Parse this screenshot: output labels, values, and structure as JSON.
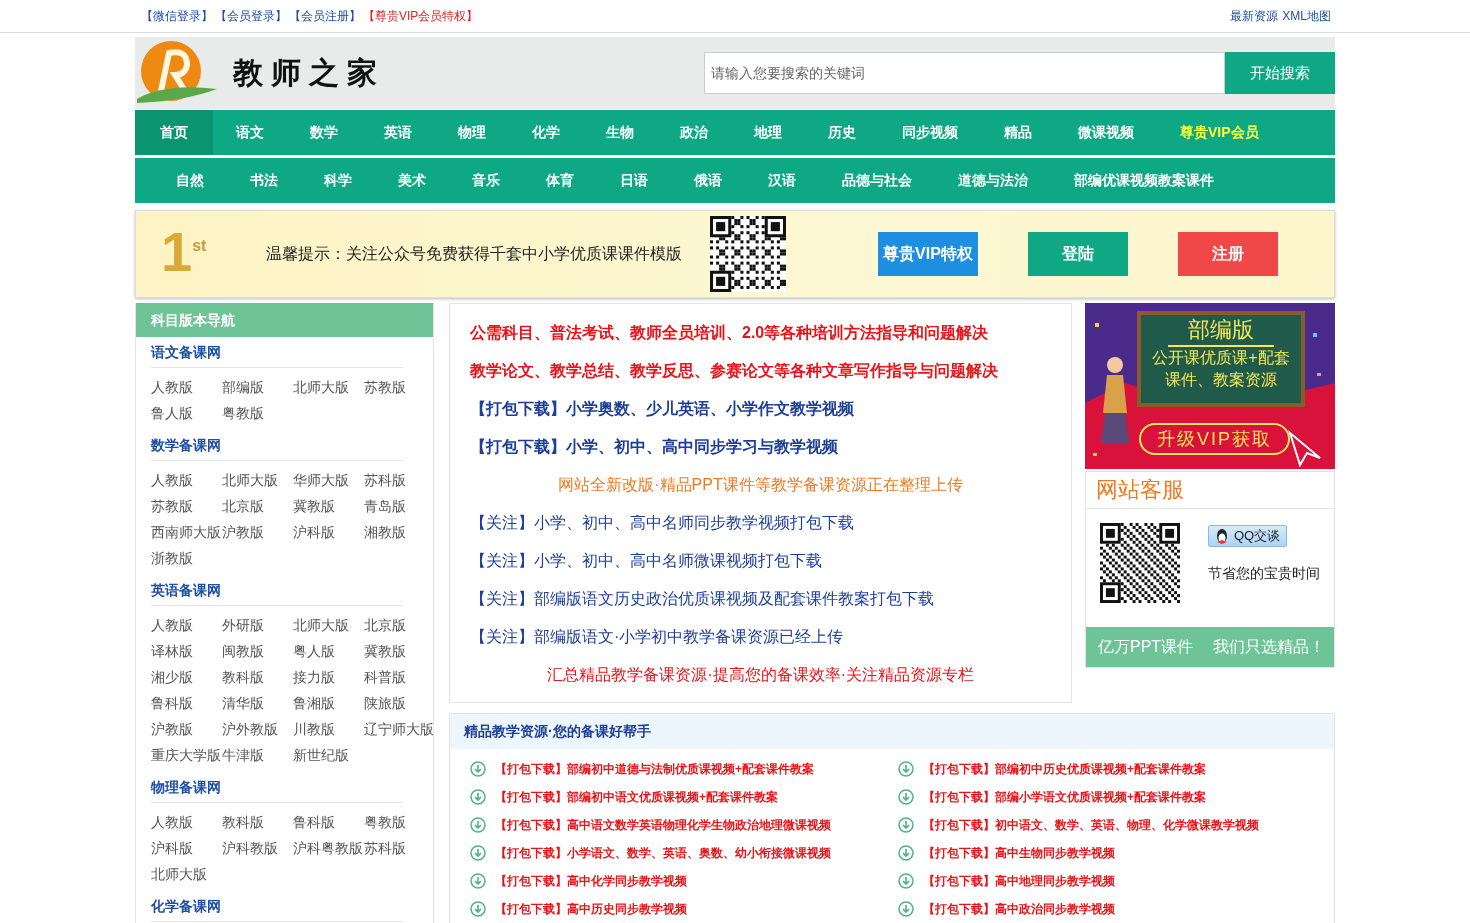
{
  "top_bar": {
    "left_links": [
      {
        "text": "【微信登录】",
        "kind": "normal"
      },
      {
        "text": "【会员登录】",
        "kind": "normal"
      },
      {
        "text": "【会员注册】",
        "kind": "normal"
      },
      {
        "text": "【尊贵VIP会员特权】",
        "kind": "vip"
      }
    ],
    "right_links": [
      "最新资源",
      "XML地图"
    ]
  },
  "header": {
    "site_title": "教师之家",
    "search": {
      "placeholder": "请输入您要搜索的关键词"
    },
    "search_button": "开始搜索"
  },
  "nav_primary": [
    {
      "label": "首页",
      "selected": true,
      "kind": "normal"
    },
    {
      "label": "语文",
      "selected": false,
      "kind": "normal"
    },
    {
      "label": "数学",
      "selected": false,
      "kind": "normal"
    },
    {
      "label": "英语",
      "selected": false,
      "kind": "normal"
    },
    {
      "label": "物理",
      "selected": false,
      "kind": "normal"
    },
    {
      "label": "化学",
      "selected": false,
      "kind": "normal"
    },
    {
      "label": "生物",
      "selected": false,
      "kind": "normal"
    },
    {
      "label": "政治",
      "selected": false,
      "kind": "normal"
    },
    {
      "label": "地理",
      "selected": false,
      "kind": "normal"
    },
    {
      "label": "历史",
      "selected": false,
      "kind": "normal"
    },
    {
      "label": "同步视频",
      "selected": false,
      "kind": "normal"
    },
    {
      "label": "精品",
      "selected": false,
      "kind": "normal"
    },
    {
      "label": "微课视频",
      "selected": false,
      "kind": "normal"
    },
    {
      "label": "尊贵VIP会员",
      "selected": false,
      "kind": "vip"
    }
  ],
  "nav_secondary": [
    "自然",
    "书法",
    "科学",
    "美术",
    "音乐",
    "体育",
    "日语",
    "俄语",
    "汉语",
    "品德与社会",
    "道德与法治",
    "部编优课视频教案课件"
  ],
  "notice": {
    "decoration": "1$^{st}$",
    "text": "温馨提示：关注公众号免费获得千套中小学优质课课件模版",
    "buttons": [
      {
        "label": "尊贵VIP特权",
        "kind": "vip"
      },
      {
        "label": "登陆",
        "kind": "login"
      },
      {
        "label": "注册",
        "kind": "register"
      }
    ]
  },
  "sidebar": {
    "title": "科目版本导航",
    "sections": [
      {
        "title": "语文备课网",
        "items": [
          "人教版",
          "部编版",
          "北师大版",
          "苏教版",
          "鲁人版",
          "粤教版"
        ]
      },
      {
        "title": "数学备课网",
        "items": [
          "人教版",
          "北师大版",
          "华师大版",
          "苏科版",
          "苏教版",
          "北京版",
          "冀教版",
          "青岛版",
          "西南师大版",
          "沪教版",
          "沪科版",
          "湘教版",
          "浙教版"
        ]
      },
      {
        "title": "英语备课网",
        "items": [
          "人教版",
          "外研版",
          "北师大版",
          "北京版",
          "译林版",
          "闽教版",
          "粤人版",
          "冀教版",
          "湘少版",
          "教科版",
          "接力版",
          "科普版",
          "鲁科版",
          "清华版",
          "鲁湘版",
          "陕旅版",
          "沪教版",
          "沪外教版",
          "川教版",
          "辽宁师大版",
          "重庆大学版",
          "牛津版",
          "新世纪版"
        ]
      },
      {
        "title": "物理备课网",
        "items": [
          "人教版",
          "教科版",
          "鲁科版",
          "粤教版",
          "沪科版",
          "沪科教版",
          "沪科粤教版",
          "苏科版",
          "北师大版"
        ]
      },
      {
        "title": "化学备课网"
      }
    ]
  },
  "announcements": [
    {
      "text": "公需科目、普法考试、教师全员培训、2.0等各种培训方法指导和问题解决",
      "kind": "bold_red"
    },
    {
      "text": "教学论文、教学总结、教学反思、参赛论文等各种文章写作指导与问题解决",
      "kind": "bold_red"
    },
    {
      "text": "【打包下载】小学奥数、少儿英语、小学作文教学视频",
      "kind": "bold_blue"
    },
    {
      "text": "【打包下载】小学、初中、高中同步学习与教学视频",
      "kind": "bold_blue"
    },
    {
      "text": "网站全新改版·精品PPT课件等教学备课资源正在整理上传",
      "kind": "center_orange"
    },
    {
      "text": "【关注】小学、初中、高中名师同步教学视频打包下载",
      "kind": "blue"
    },
    {
      "text": "【关注】小学、初中、高中名师微课视频打包下载",
      "kind": "blue"
    },
    {
      "text": "【关注】部编版语文历史政治优质课视频及配套课件教案打包下载",
      "kind": "blue"
    },
    {
      "text": "【关注】部编版语文·小学初中教学备课资源已经上传",
      "kind": "blue"
    },
    {
      "text": "汇总精品教学备课资源·提高您的备课效率·关注精品资源专栏",
      "kind": "center_red"
    }
  ],
  "ad_banner": {
    "heading": "部编版",
    "lines": [
      "公开课优质课+配套",
      "课件、教案资源"
    ],
    "button": "升级VIP获取"
  },
  "customer_service": {
    "title": "网站客服",
    "qq_button": "QQ交谈",
    "note": "节省您的宝贵时间",
    "footer": [
      "亿万PPT课件",
      "我们只选精品！"
    ]
  },
  "resources": {
    "title": "精品教学资源·您的备课好帮手",
    "items": [
      "【打包下载】部编初中道德与法制优质课视频+配套课件教案",
      "【打包下载】部编初中历史优质课视频+配套课件教案",
      "【打包下载】部编初中语文优质课视频+配套课件教案",
      "【打包下载】部编小学语文优质课视频+配套课件教案",
      "【打包下载】高中语文数学英语物理化学生物政治地理微课视频",
      "【打包下载】初中语文、数学、英语、物理、化学微课教学视频",
      "【打包下载】小学语文、数学、英语、奥数、幼小衔接微课视频",
      "【打包下载】高中生物同步教学视频",
      "【打包下载】高中化学同步教学视频",
      "【打包下载】高中地理同步教学视频",
      "【打包下载】高中历史同步教学视频",
      "【打包下载】高中政治同步教学视频"
    ]
  }
}
